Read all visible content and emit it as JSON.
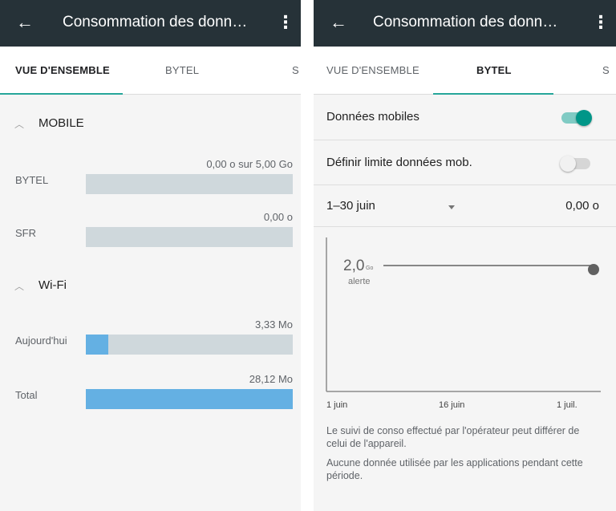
{
  "left": {
    "appbar": {
      "title": "Consommation des donn…",
      "back_icon": "arrow-left",
      "menu_icon": "more-vert"
    },
    "tabs": [
      {
        "label": "VUE D'ENSEMBLE",
        "active": true
      },
      {
        "label": "BYTEL",
        "active": false
      },
      {
        "label": "S",
        "active": false
      }
    ],
    "sections": {
      "mobile": "MOBILE",
      "wifi": "Wi-Fi"
    },
    "usage": {
      "bytel": {
        "label": "BYTEL",
        "value": "0,00 o sur 5,00 Go",
        "fraction": 0
      },
      "sfr": {
        "label": "SFR",
        "value": "0,00 o",
        "fraction": 0
      },
      "today": {
        "label": "Aujourd'hui",
        "value": "3,33 Mo",
        "fraction": 0.11
      },
      "total": {
        "label": "Total",
        "value": "28,12 Mo",
        "fraction": 1.0
      }
    }
  },
  "right": {
    "appbar": {
      "title": "Consommation des donn…",
      "back_icon": "arrow-left",
      "menu_icon": "more-vert"
    },
    "tabs": [
      {
        "label": "VUE D'ENSEMBLE",
        "active": false
      },
      {
        "label": "BYTEL",
        "active": true
      },
      {
        "label": "S",
        "active": false
      }
    ],
    "mobile_data": {
      "label": "Données mobiles",
      "enabled": true
    },
    "limit": {
      "label": "Définir limite données mob.",
      "enabled": false
    },
    "period": {
      "label": "1–30 juin",
      "total": "0,00 o"
    },
    "chart": {
      "alert_value": "2,0",
      "alert_unit": "Go",
      "alert_label": "alerte",
      "x_labels": [
        "1 juin",
        "16 juin",
        "1 juil."
      ]
    },
    "notes": {
      "line1": "Le suivi de conso effectué par l'opérateur peut différer de celui de l'appareil.",
      "line2": "Aucune donnée utilisée par les applications pendant cette période."
    }
  },
  "colors": {
    "appbar": "#263238",
    "accent": "#009688",
    "tab_indicator": "#26a69a",
    "bar_track": "#cfd8dc",
    "bar_fill": "#64b0e3"
  }
}
